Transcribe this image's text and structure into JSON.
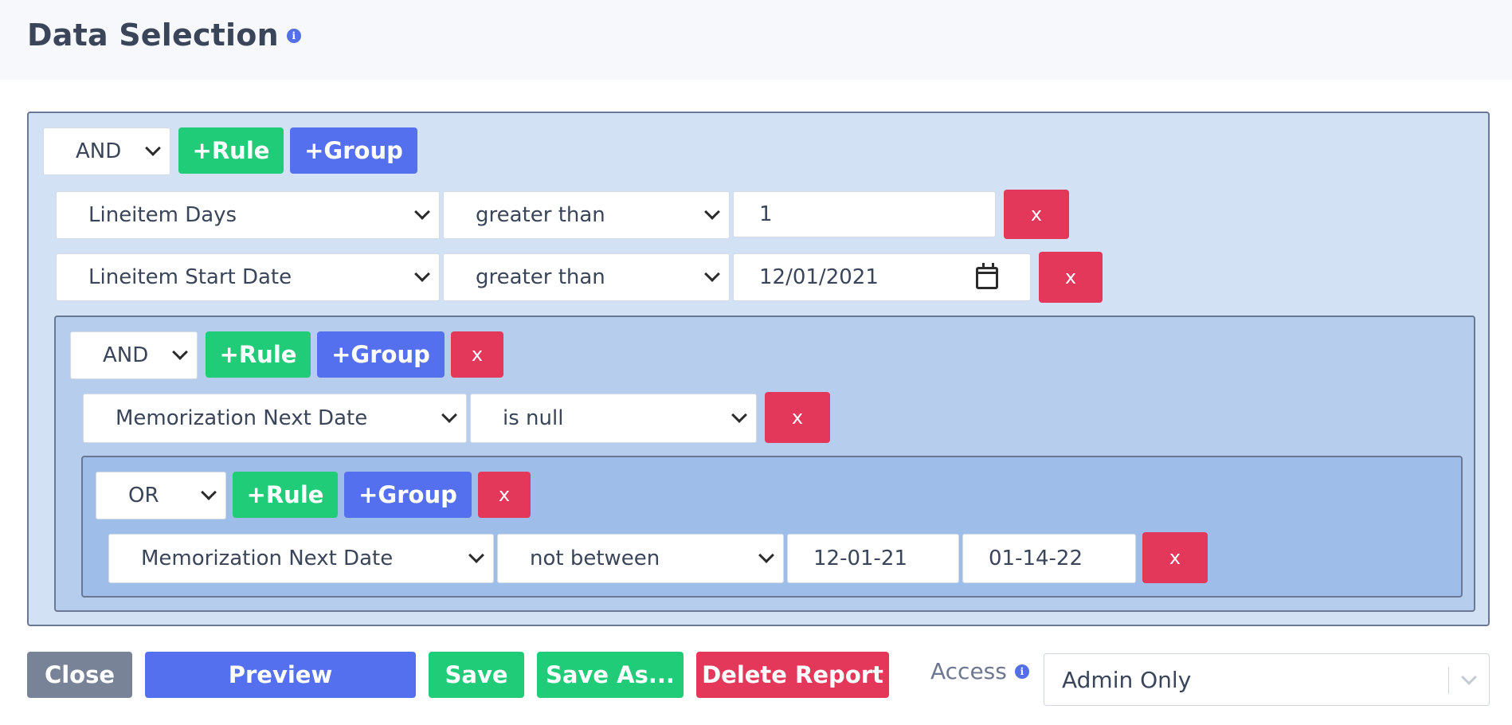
{
  "header": {
    "title": "Data Selection",
    "info_icon": "info-icon"
  },
  "root_group": {
    "condition": "AND",
    "add_rule_label": "+Rule",
    "add_group_label": "+Group",
    "rules": [
      {
        "field": "Lineitem Days",
        "operator": "greater than",
        "value": "1",
        "remove_label": "x"
      },
      {
        "field": "Lineitem Start Date",
        "operator": "greater than",
        "value": "12/01/2021",
        "remove_label": "x"
      }
    ]
  },
  "nested_group": {
    "condition": "AND",
    "add_rule_label": "+Rule",
    "add_group_label": "+Group",
    "remove_label": "x",
    "rules": [
      {
        "field": "Memorization Next Date",
        "operator": "is null",
        "remove_label": "x"
      }
    ]
  },
  "inner_group": {
    "condition": "OR",
    "add_rule_label": "+Rule",
    "add_group_label": "+Group",
    "remove_label": "x",
    "rules": [
      {
        "field": "Memorization Next Date",
        "operator": "not between",
        "value_from": "12-01-21",
        "value_to": "01-14-22",
        "remove_label": "x"
      }
    ]
  },
  "footer": {
    "close_label": "Close",
    "preview_label": "Preview",
    "save_label": "Save",
    "save_as_label": "Save As...",
    "delete_label": "Delete Report",
    "access_label": "Access",
    "access_value": "Admin Only"
  },
  "colors": {
    "green": "#21cc79",
    "blue": "#5470ee",
    "red": "#e4385a",
    "gray": "#798397"
  }
}
